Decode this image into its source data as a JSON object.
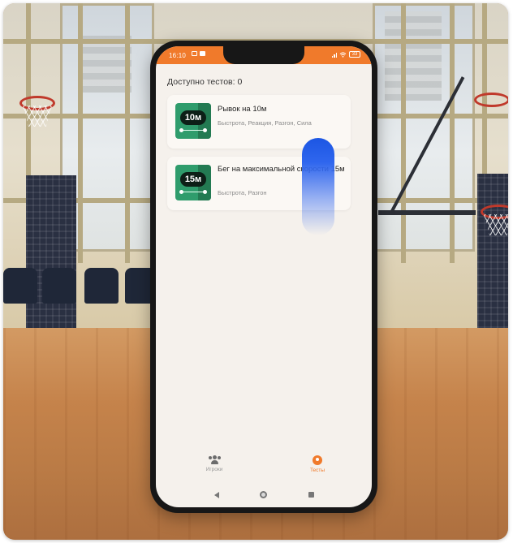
{
  "status_bar": {
    "time": "16:10",
    "battery": "33"
  },
  "header": {
    "available_tests": "Доступно тестов: 0"
  },
  "tests": [
    {
      "distance": "10м",
      "title": "Рывок на 10м",
      "tags": "Быстрота, Реакция, Разгон, Сила"
    },
    {
      "distance": "15м",
      "title": "Бег на максимальной скорости 15м",
      "tags": "Быстрота, Разгон"
    }
  ],
  "bottom_nav": {
    "items": [
      {
        "label": "Игроки",
        "icon": "people-icon",
        "active": false
      },
      {
        "label": "Тесты",
        "icon": "timer-icon",
        "active": true
      }
    ]
  },
  "colors": {
    "accent": "#f07a2b",
    "tile_green": "#2f9c6c",
    "touch_blue": "#1c56e3"
  }
}
